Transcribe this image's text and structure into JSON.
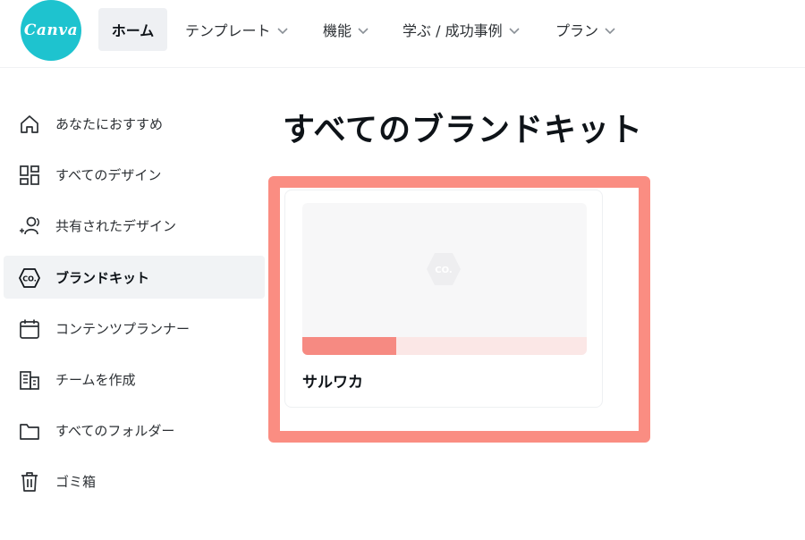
{
  "header": {
    "logo_text": "Canva",
    "nav": [
      {
        "label": "ホーム",
        "has_chevron": false,
        "active": true
      },
      {
        "label": "テンプレート",
        "has_chevron": true
      },
      {
        "label": "機能",
        "has_chevron": true
      },
      {
        "label": "学ぶ / 成功事例",
        "has_chevron": true
      },
      {
        "label": "プラン",
        "has_chevron": true
      }
    ]
  },
  "sidebar": {
    "items": [
      {
        "label": "あなたにおすすめ",
        "icon": "home-icon"
      },
      {
        "label": "すべてのデザイン",
        "icon": "grid-icon"
      },
      {
        "label": "共有されたデザイン",
        "icon": "shared-users-icon"
      },
      {
        "label": "ブランドキット",
        "icon": "brand-kit-icon",
        "active": true
      },
      {
        "label": "コンテンツプランナー",
        "icon": "calendar-icon"
      },
      {
        "label": "チームを作成",
        "icon": "building-icon"
      },
      {
        "label": "すべてのフォルダー",
        "icon": "folder-icon"
      },
      {
        "label": "ゴミ箱",
        "icon": "trash-icon"
      }
    ]
  },
  "main": {
    "title": "すべてのブランドキット",
    "brand_kits": [
      {
        "name": "サルワカ",
        "progress": 0.33,
        "thumbnail_mark": "CO."
      }
    ]
  },
  "colors": {
    "logo": "#1ec3cf",
    "highlight": "#fa8d82",
    "progress": "#f68a82",
    "progress_track": "#fbe7e6"
  }
}
